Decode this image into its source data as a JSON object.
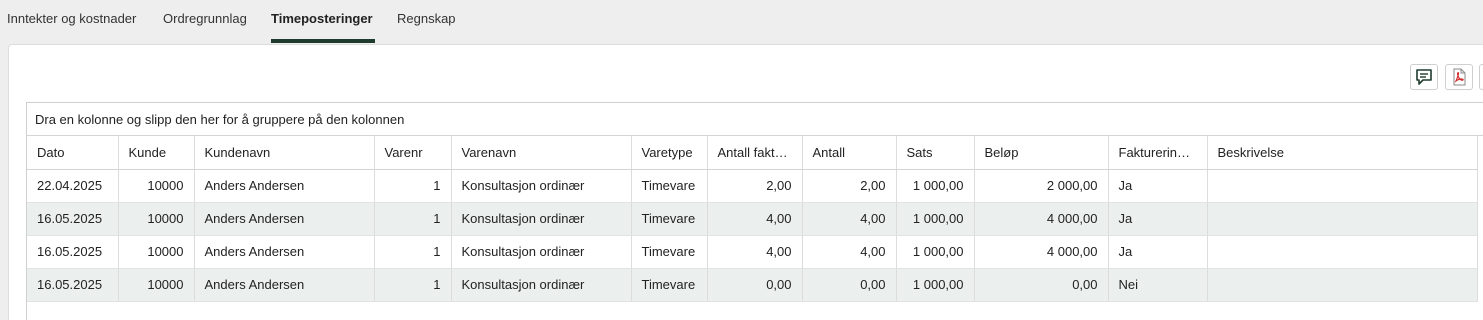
{
  "tabs": [
    {
      "label": "Inntekter og kostnader",
      "active": false
    },
    {
      "label": "Ordregrunnlag",
      "active": false
    },
    {
      "label": "Timeposteringer",
      "active": true
    },
    {
      "label": "Regnskap",
      "active": false
    }
  ],
  "toolbar": {
    "icons": [
      "comment-icon",
      "pdf-icon"
    ]
  },
  "grid": {
    "group_hint": "Dra en kolonne og slipp den her for å gruppere på den kolonnen",
    "columns": [
      "Dato",
      "Kunde",
      "Kundenavn",
      "Varenr",
      "Varenavn",
      "Varetype",
      "Antall faktu…",
      "Antall",
      "Sats",
      "Beløp",
      "Fakturerings…",
      "Beskrivelse"
    ],
    "rows": [
      [
        "22.04.2025",
        "10000",
        "Anders Andersen",
        "1",
        "Konsultasjon ordinær",
        "Timevare",
        "2,00",
        "2,00",
        "1 000,00",
        "2 000,00",
        "Ja",
        ""
      ],
      [
        "16.05.2025",
        "10000",
        "Anders Andersen",
        "1",
        "Konsultasjon ordinær",
        "Timevare",
        "4,00",
        "4,00",
        "1 000,00",
        "4 000,00",
        "Ja",
        ""
      ],
      [
        "16.05.2025",
        "10000",
        "Anders Andersen",
        "1",
        "Konsultasjon ordinær",
        "Timevare",
        "4,00",
        "4,00",
        "1 000,00",
        "4 000,00",
        "Ja",
        ""
      ],
      [
        "16.05.2025",
        "10000",
        "Anders Andersen",
        "1",
        "Konsultasjon ordinær",
        "Timevare",
        "0,00",
        "0,00",
        "1 000,00",
        "0,00",
        "Nei",
        ""
      ]
    ]
  },
  "colors": {
    "active_tab_underline": "#1f3b2e",
    "alt_row": "#ebf0ef",
    "pdf_red": "#d32f2f",
    "comment_green": "#1f3b2e"
  }
}
